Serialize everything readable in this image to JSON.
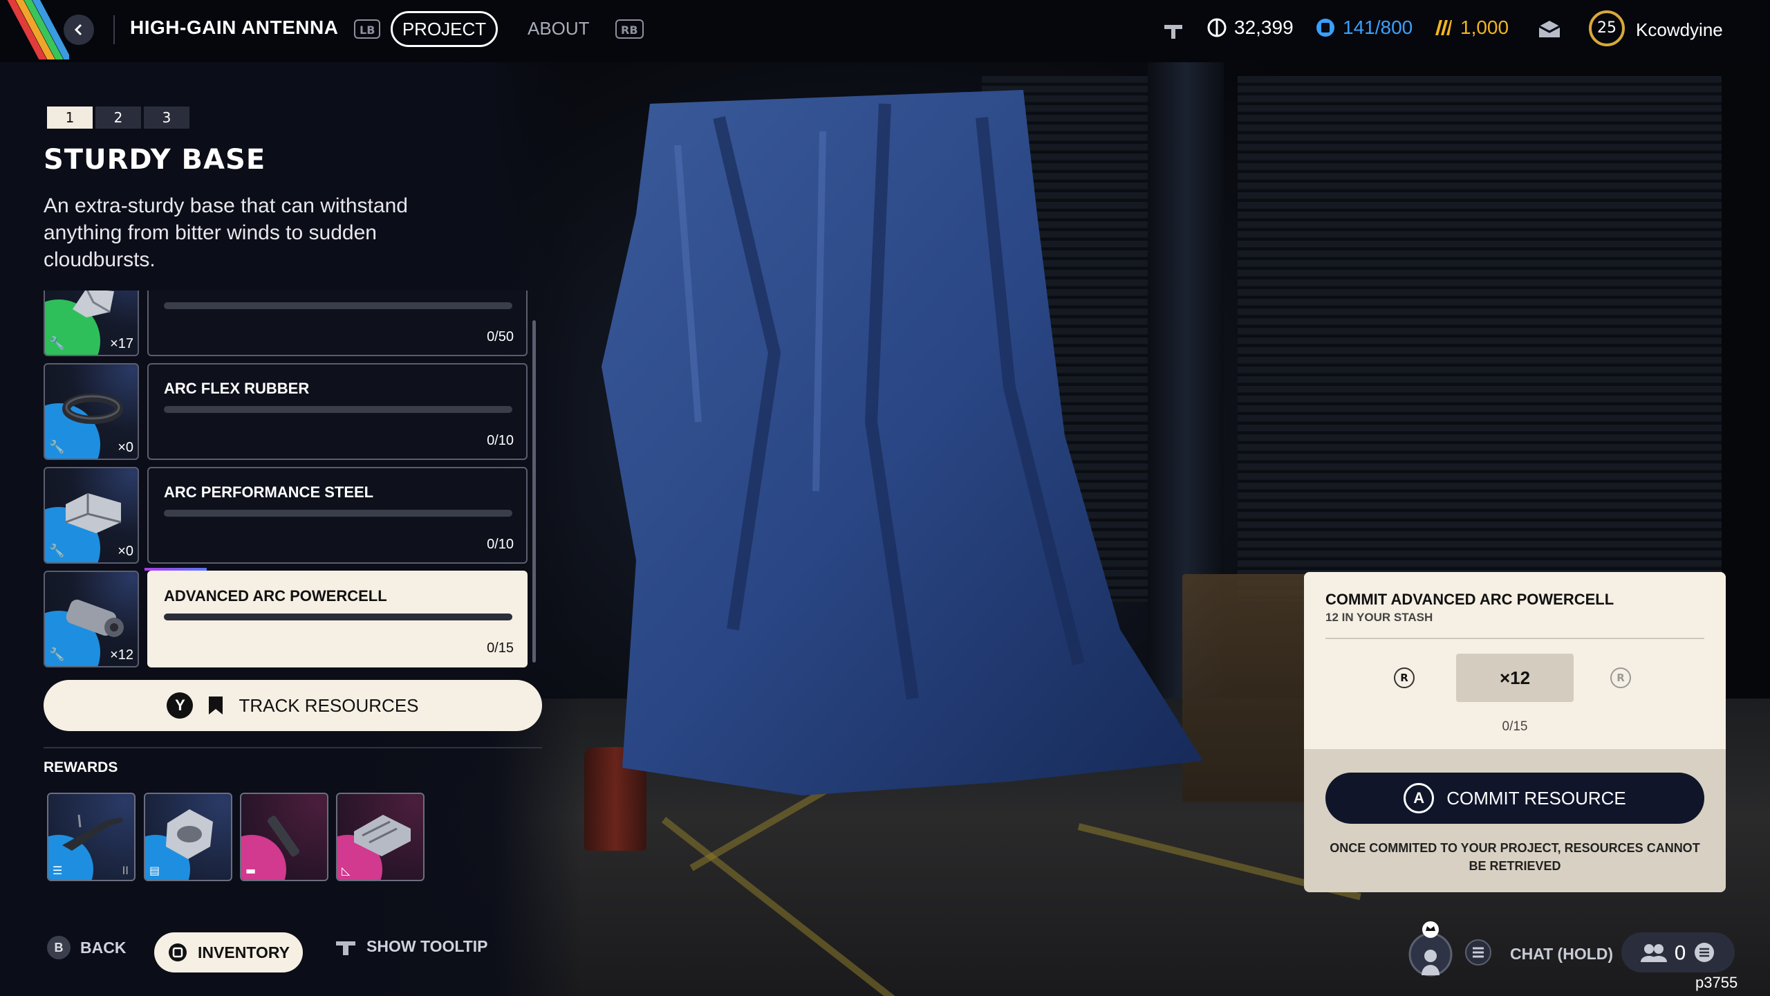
{
  "topbar": {
    "title": "HIGH-GAIN ANTENNA",
    "lb": "LB",
    "rb": "RB",
    "tab_project": "PROJECT",
    "tab_about": "ABOUT",
    "currency": "32,399",
    "stash": "141/800",
    "tokens": "1,000",
    "level": "25",
    "username": "Kcowdyine"
  },
  "pager": [
    "1",
    "2",
    "3"
  ],
  "project": {
    "title": "STURDY BASE",
    "description": "An extra-sturdy base that can withstand anything from bitter winds to sudden cloudbursts."
  },
  "resources": [
    {
      "name": "",
      "qty": "×17",
      "progress": "0/50",
      "rarity_color": "#2fbf5a"
    },
    {
      "name": "ARC FLEX RUBBER",
      "qty": "×0",
      "progress": "0/10",
      "rarity_color": "#1e8fe0"
    },
    {
      "name": "ARC PERFORMANCE STEEL",
      "qty": "×0",
      "progress": "0/10",
      "rarity_color": "#1e8fe0"
    },
    {
      "name": "ADVANCED ARC POWERCELL",
      "qty": "×12",
      "progress": "0/15",
      "rarity_color": "#1e8fe0"
    }
  ],
  "track": {
    "badge": "Y",
    "label": "TRACK RESOURCES"
  },
  "rewards": {
    "label": "REWARDS",
    "items": [
      {
        "color": "#1e8fe0",
        "tag2": "II"
      },
      {
        "color": "#1e8fe0",
        "tag2": ""
      },
      {
        "color": "#d13a8e",
        "tag2": ""
      },
      {
        "color": "#d13a8e",
        "tag2": ""
      }
    ]
  },
  "bottombar": {
    "back_badge": "B",
    "back": "BACK",
    "inventory": "INVENTORY",
    "tooltip": "SHOW TOOLTIP",
    "chat": "CHAT (HOLD)",
    "party_count": "0",
    "user_id": "p3755"
  },
  "commit": {
    "title": "COMMIT ADVANCED ARC POWERCELL",
    "subtitle": "12 IN YOUR STASH",
    "quantity": "×12",
    "stick_left": "R",
    "stick_right": "R",
    "progress": "0/15",
    "button_badge": "A",
    "button": "COMMIT RESOURCE",
    "note": "ONCE COMMITED TO YOUR PROJECT, RESOURCES CANNOT BE RETRIEVED"
  },
  "colors": {
    "accent_cream": "#f6efe4",
    "stash_blue": "#3aa0ff",
    "token_gold": "#f2b51c",
    "panel_dark": "#10152a"
  }
}
